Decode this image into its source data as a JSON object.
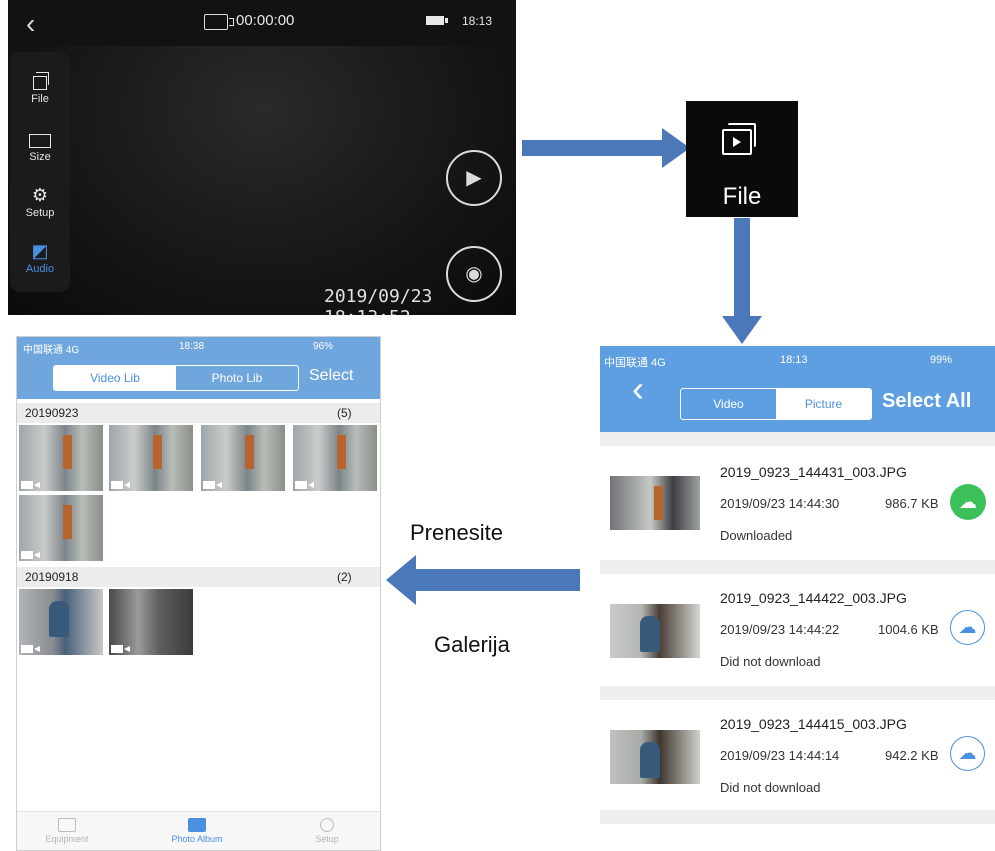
{
  "camera_view": {
    "back_icon": "chevron-left-icon",
    "record_time": "00:00:00",
    "clock": "18:13",
    "timestamp": "2019/09/23  18:13:52",
    "side_menu": [
      {
        "label": "File",
        "icon": "file-icon"
      },
      {
        "label": "Size",
        "icon": "size-icon"
      },
      {
        "label": "Setup",
        "icon": "gear-icon"
      },
      {
        "label": "Audio",
        "icon": "headphones-icon"
      }
    ]
  },
  "file_badge": {
    "label": "File"
  },
  "labels": {
    "transfer": "Prenesite",
    "gallery": "Galerija"
  },
  "gallery_phone": {
    "status": {
      "carrier": "中国联通  4G",
      "time": "18:38",
      "battery": "96%"
    },
    "tabs": [
      "Video Lib",
      "Photo Lib"
    ],
    "active_tab": 0,
    "select_label": "Select",
    "groups": [
      {
        "date": "20190923",
        "count": "(5)"
      },
      {
        "date": "20190918",
        "count": "(2)"
      }
    ],
    "tabbar": [
      "Equipment",
      "Photo Album",
      "Setup"
    ]
  },
  "file_list_phone": {
    "status": {
      "carrier": "中国联通  4G",
      "time": "18:13",
      "battery": "99%"
    },
    "tabs": [
      "Video",
      "Picture"
    ],
    "active_tab": 1,
    "select_all_label": "Select All",
    "files": [
      {
        "name": "2019_0923_144431_003.JPG",
        "date": "2019/09/23 14:44:30",
        "size": "986.7 KB",
        "status": "Downloaded",
        "downloaded": true
      },
      {
        "name": "2019_0923_144422_003.JPG",
        "date": "2019/09/23 14:44:22",
        "size": "1004.6 KB",
        "status": "Did not download",
        "downloaded": false
      },
      {
        "name": "2019_0923_144415_003.JPG",
        "date": "2019/09/23 14:44:14",
        "size": "942.2 KB",
        "status": "Did not download",
        "downloaded": false
      }
    ]
  },
  "colors": {
    "accent": "#4a90e2",
    "header_blue": "#5d9fe1",
    "download_green": "#3cc05a",
    "arrow": "#4a78b8"
  }
}
